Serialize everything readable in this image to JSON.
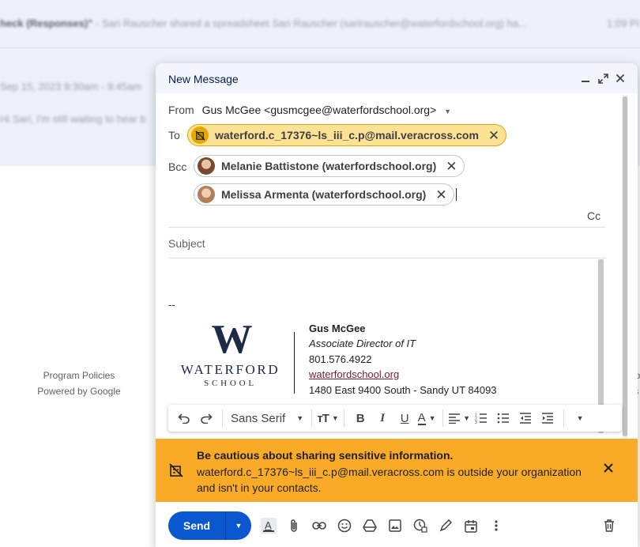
{
  "background": {
    "row1_subject": "heck (Responses)\"",
    "row1_snippet": " - Sari Rauscher shared a spreadsheet Sari Rauscher (sarirauscher@waterfordschool.org) ha...",
    "row1_time": "1:09 PM",
    "row2_text": "Sep 15, 2023 9:30am - 9:45am",
    "row3_text": "Hi Sari, I'm still waiting to hear b",
    "footer_policies": "Program Policies",
    "footer_powered": "Powered by Google",
    "right_edge_1": "go",
    "right_edge_2": "ils"
  },
  "compose": {
    "title": "New Message",
    "from_label": "From",
    "from_value": "Gus McGee <gusmcgee@waterfordschool.org>",
    "to_label": "To",
    "to_chip": "waterford.c_17376~ls_iii_c.p@mail.veracross.com",
    "bcc_label": "Bcc",
    "bcc_chips": [
      "Melanie Battistone (waterfordschool.org)",
      "Melissa Armenta (waterfordschool.org)"
    ],
    "cc_label": "Cc",
    "subject_placeholder": "Subject",
    "sig_dashes": "--",
    "logo_w": "W",
    "logo_word": "WATERFORD",
    "logo_school": "SCHOOL",
    "sig_name": "Gus McGee",
    "sig_title": "Associate Director of IT",
    "sig_phone": "801.576.4922",
    "sig_link": "waterfordschool.org",
    "sig_address": "1480 East 9400 South - Sandy UT 84093"
  },
  "format_bar": {
    "font": "Sans Serif"
  },
  "warning": {
    "title": "Be cautious about sharing sensitive information.",
    "body": "waterford.c_17376~ls_iii_c.p@mail.veracross.com is outside your organization and isn't in your contacts."
  },
  "bottom": {
    "send_label": "Send"
  },
  "colors": {
    "warning_bg": "#f9ab27",
    "send_bg": "#0b57d0",
    "header_bg": "#f2f6fc",
    "logo_navy": "#1d2a48"
  }
}
